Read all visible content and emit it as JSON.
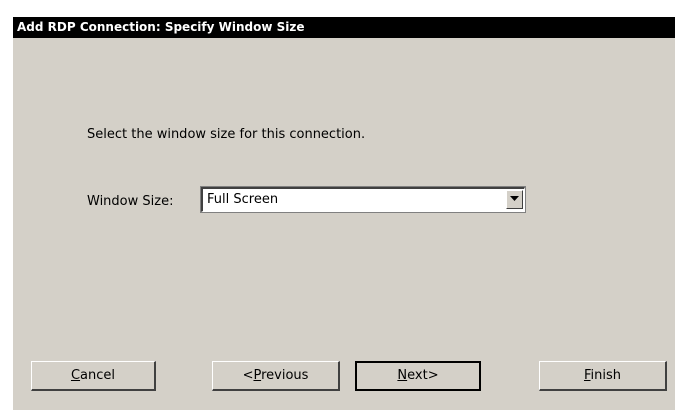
{
  "window": {
    "title": "Add RDP Connection: Specify Window Size"
  },
  "main": {
    "prompt": "Select the window size for this connection.",
    "window_size_label": "Window Size:",
    "window_size_value": "Full Screen"
  },
  "buttons": {
    "cancel": {
      "mnemonic": "C",
      "rest": "ancel"
    },
    "previous": {
      "prefix": "<",
      "mnemonic": "P",
      "rest": "revious"
    },
    "next": {
      "mnemonic": "N",
      "rest": "ext>"
    },
    "finish": {
      "mnemonic": "F",
      "rest": "inish"
    }
  },
  "icons": {
    "combo_arrow": "triangle-down-icon"
  }
}
